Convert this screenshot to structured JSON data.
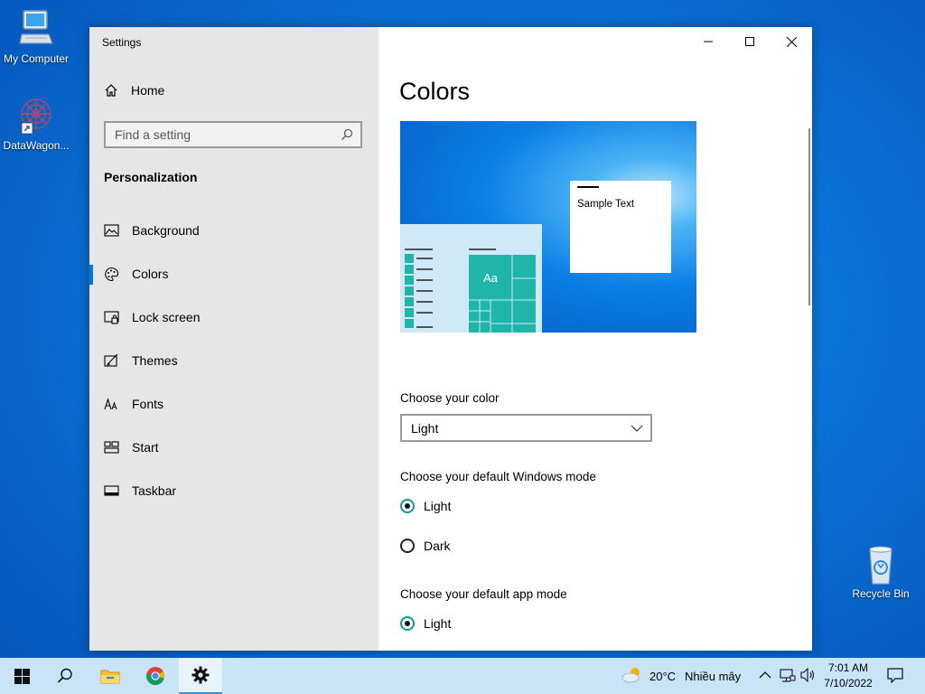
{
  "desktop": {
    "icons": [
      {
        "label": "My Computer",
        "icon": "computer-icon"
      },
      {
        "label": "DataWagon...",
        "icon": "app-shortcut-icon"
      },
      {
        "label": "Recycle Bin",
        "icon": "recycle-bin-icon"
      }
    ]
  },
  "window": {
    "title": "Settings",
    "controls": {
      "minimize": "minimize-icon",
      "maximize": "maximize-icon",
      "close": "close-icon"
    }
  },
  "nav": {
    "home_label": "Home",
    "search_placeholder": "Find a setting",
    "section": "Personalization",
    "items": [
      {
        "label": "Background",
        "icon": "picture-icon"
      },
      {
        "label": "Colors",
        "icon": "palette-icon",
        "active": true
      },
      {
        "label": "Lock screen",
        "icon": "lock-screen-icon"
      },
      {
        "label": "Themes",
        "icon": "themes-icon"
      },
      {
        "label": "Fonts",
        "icon": "fonts-icon"
      },
      {
        "label": "Start",
        "icon": "start-icon"
      },
      {
        "label": "Taskbar",
        "icon": "taskbar-icon"
      }
    ]
  },
  "content": {
    "title": "Colors",
    "preview": {
      "sample_text": "Sample Text",
      "tile_text": "Aa"
    },
    "choose_color": {
      "label": "Choose your color",
      "value": "Light"
    },
    "windows_mode": {
      "label": "Choose your default Windows mode",
      "options": [
        "Light",
        "Dark"
      ],
      "selected": "Light"
    },
    "app_mode": {
      "label": "Choose your default app mode",
      "options": [
        "Light"
      ],
      "selected": "Light"
    },
    "accent_color": "#0a9a9a"
  },
  "taskbar": {
    "apps": [
      "start-icon",
      "search-icon",
      "file-explorer-icon",
      "chrome-icon",
      "settings-icon"
    ],
    "weather": {
      "temp": "20°C",
      "desc": "Nhiều mây"
    },
    "time": "7:01 AM",
    "date": "7/10/2022"
  }
}
